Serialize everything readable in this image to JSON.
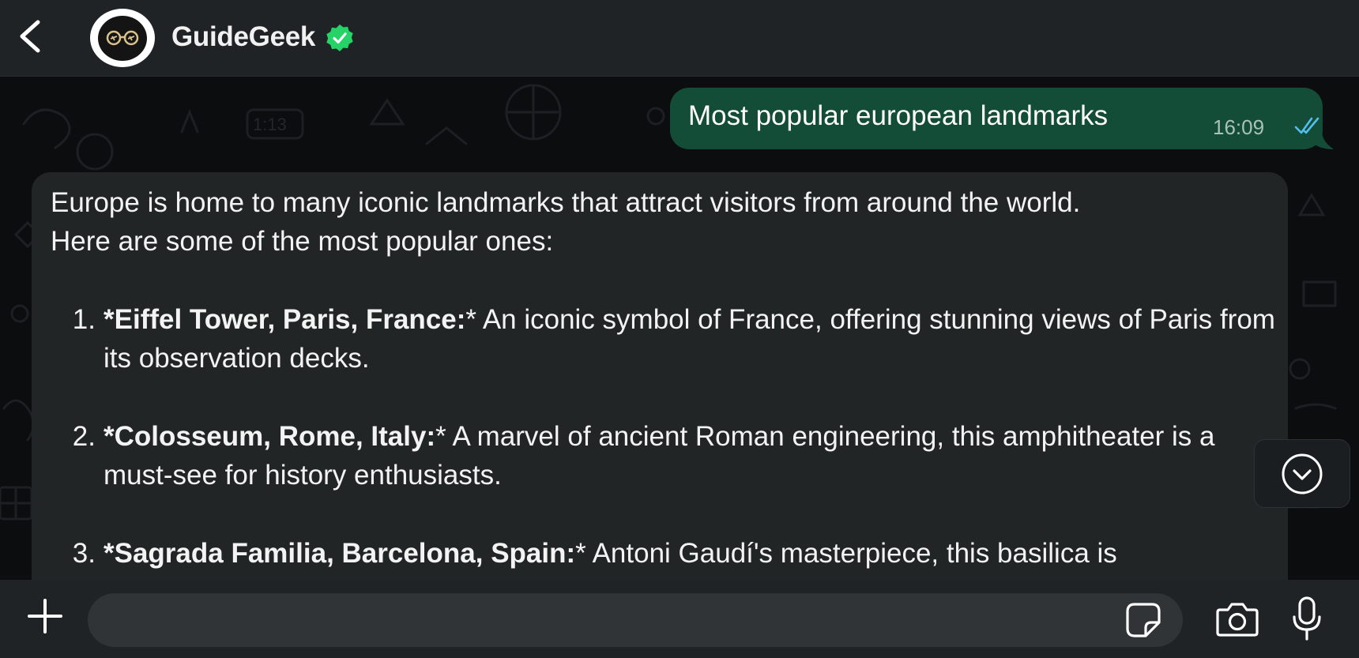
{
  "header": {
    "contact_name": "GuideGeek",
    "back_icon": "chevron-left-icon",
    "verified_icon": "verified-badge-icon",
    "verified_color": "#25d366"
  },
  "messages": {
    "outgoing": {
      "text": "Most popular european landmarks",
      "time": "16:09",
      "status_icon": "double-check-icon",
      "status_color": "#53bdeb",
      "bubble_color": "#134d37"
    },
    "incoming": {
      "intro_line1": "Europe is home to many iconic landmarks that attract visitors from around the world.",
      "intro_line2": "Here are some of the most popular ones:",
      "items": [
        {
          "num": "1.",
          "title": "*Eiffel Tower, Paris, France:",
          "rest": "* An iconic symbol of France, offering stunning views of Paris from its observation decks."
        },
        {
          "num": "2.",
          "title": "*Colosseum, Rome, Italy:",
          "rest": "* A marvel of ancient Roman engineering, this amphitheater is a must-see for history enthusiasts."
        },
        {
          "num": "3.",
          "title": "*Sagrada Familia, Barcelona, Spain:",
          "rest": "* Antoni Gaudí's masterpiece, this basilica is"
        }
      ]
    }
  },
  "input_bar": {
    "placeholder": "",
    "icons": [
      "plus-icon",
      "sticker-icon",
      "camera-icon",
      "microphone-icon"
    ]
  }
}
